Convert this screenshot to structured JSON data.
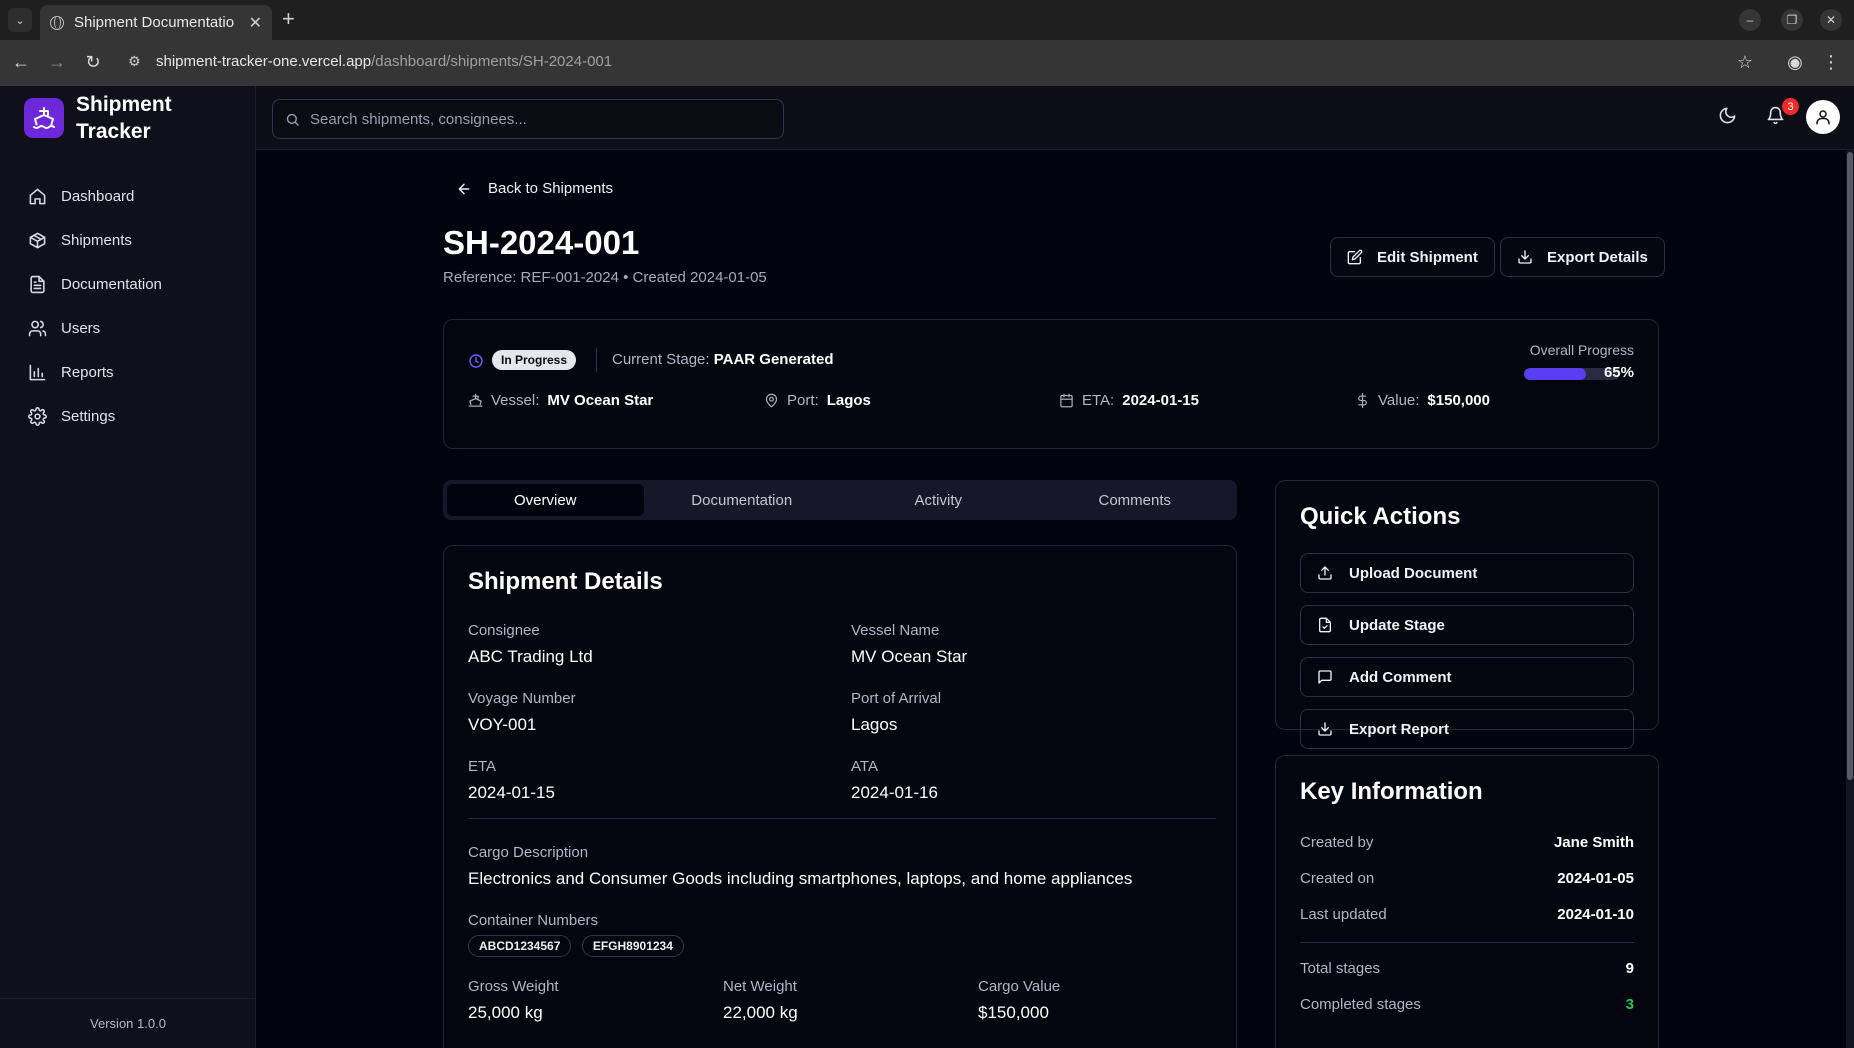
{
  "browser": {
    "tab_title": "Shipment Documentatio",
    "url_host": "shipment-tracker-one.vercel.app",
    "url_path": "/dashboard/shipments/SH-2024-001"
  },
  "sidebar": {
    "brand_name": "Shipment Tracker",
    "items": [
      {
        "label": "Dashboard",
        "icon": "home-icon"
      },
      {
        "label": "Shipments",
        "icon": "package-icon"
      },
      {
        "label": "Documentation",
        "icon": "file-text-icon"
      },
      {
        "label": "Users",
        "icon": "users-icon"
      },
      {
        "label": "Reports",
        "icon": "bar-chart-icon"
      },
      {
        "label": "Settings",
        "icon": "gear-icon"
      }
    ],
    "version": "Version 1.0.0"
  },
  "topbar": {
    "search_placeholder": "Search shipments, consignees...",
    "notification_count": "3"
  },
  "page": {
    "back_label": "Back to Shipments",
    "title": "SH-2024-001",
    "subtitle": "Reference: REF-001-2024 • Created 2024-01-05",
    "edit_label": "Edit Shipment",
    "export_label": "Export Details"
  },
  "status": {
    "badge": "In Progress",
    "stage_label": "Current Stage:",
    "stage_value": "PAAR Generated",
    "vessel_label": "Vessel:",
    "vessel_value": "MV Ocean Star",
    "port_label": "Port:",
    "port_value": "Lagos",
    "eta_label": "ETA:",
    "eta_value": "2024-01-15",
    "value_label": "Value:",
    "value_value": "$150,000",
    "progress_label": "Overall Progress",
    "progress_text": "65%",
    "progress_fraction": 0.65,
    "accent_color": "#5b3ef2"
  },
  "tabs": [
    "Overview",
    "Documentation",
    "Activity",
    "Comments"
  ],
  "details": {
    "heading": "Shipment Details",
    "consignee_label": "Consignee",
    "consignee": "ABC Trading Ltd",
    "vessel_label": "Vessel Name",
    "vessel": "MV Ocean Star",
    "voyage_label": "Voyage Number",
    "voyage": "VOY-001",
    "port_label": "Port of Arrival",
    "port": "Lagos",
    "eta_label": "ETA",
    "eta": "2024-01-15",
    "ata_label": "ATA",
    "ata": "2024-01-16",
    "cargo_label": "Cargo Description",
    "cargo": "Electronics and Consumer Goods including smartphones, laptops, and home appliances",
    "containers_label": "Container Numbers",
    "containers": [
      "ABCD1234567",
      "EFGH8901234"
    ],
    "gross_label": "Gross Weight",
    "gross": "25,000 kg",
    "net_label": "Net Weight",
    "net": "22,000 kg",
    "cargo_value_label": "Cargo Value",
    "cargo_value": "$150,000"
  },
  "quick_actions": {
    "heading": "Quick Actions",
    "items": [
      {
        "label": "Upload Document",
        "icon": "upload-icon"
      },
      {
        "label": "Update Stage",
        "icon": "file-icon"
      },
      {
        "label": "Add Comment",
        "icon": "message-icon"
      },
      {
        "label": "Export Report",
        "icon": "download-icon"
      }
    ]
  },
  "key_info": {
    "heading": "Key Information",
    "created_by_label": "Created by",
    "created_by": "Jane Smith",
    "created_on_label": "Created on",
    "created_on": "2024-01-05",
    "updated_label": "Last updated",
    "updated": "2024-01-10",
    "total_stages_label": "Total stages",
    "total_stages": "9",
    "completed_label": "Completed stages",
    "completed": "3",
    "completed_color": "#22c55e"
  }
}
